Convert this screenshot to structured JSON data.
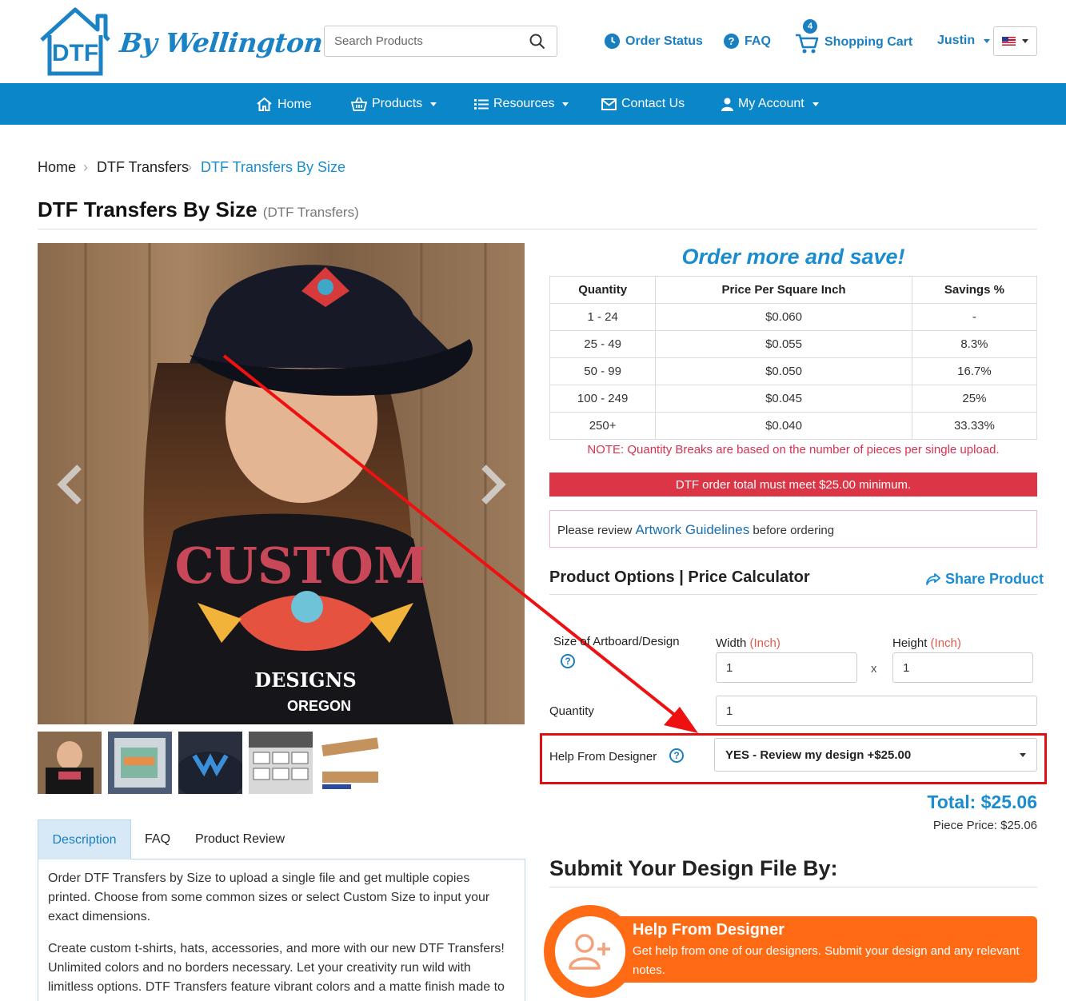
{
  "brand": {
    "logo_letters": "DTF",
    "script_text": "By Wellington",
    "primary_color": "#0a86c9"
  },
  "search": {
    "placeholder": "Search Products"
  },
  "header": {
    "order_status": "Order Status",
    "faq": "FAQ",
    "cart_label": "Shopping Cart",
    "cart_count": "4",
    "user": "Justin"
  },
  "nav": {
    "home": "Home",
    "products": "Products",
    "resources": "Resources",
    "contact": "Contact Us",
    "account": "My Account"
  },
  "breadcrumb": [
    "Home",
    "DTF Transfers",
    "DTF Transfers By Size"
  ],
  "page": {
    "title": "DTF Transfers By Size",
    "subtitle": "(DTF Transfers)"
  },
  "tabs": [
    "Description",
    "FAQ",
    "Product Review"
  ],
  "description": {
    "p1": "Order DTF Transfers by Size to upload a single file and get multiple copies printed. Choose from some common sizes or select Custom Size to input your exact dimensions.",
    "p2": "Create custom t-shirts, hats, accessories, and more with our new DTF Transfers! Unlimited colors and no borders necessary. Let your creativity run wild with limitless options. DTF Transfers feature vibrant colors and a matte finish made to"
  },
  "pricing": {
    "headline": "Order more and save!",
    "headers": [
      "Quantity",
      "Price Per Square Inch",
      "Savings %"
    ],
    "rows": [
      [
        "1 - 24",
        "$0.060",
        "-"
      ],
      [
        "25 - 49",
        "$0.055",
        "8.3%"
      ],
      [
        "50 - 99",
        "$0.050",
        "16.7%"
      ],
      [
        "100 - 249",
        "$0.045",
        "25%"
      ],
      [
        "250+",
        "$0.040",
        "33.33%"
      ]
    ],
    "note": "NOTE: Quantity Breaks are based on the number of pieces per single upload.",
    "minimum": "DTF order total must meet $25.00 minimum.",
    "review_prefix": "Please review ",
    "review_link": "Artwork Guidelines",
    "review_suffix": " before ordering"
  },
  "options": {
    "title": "Product Options | Price Calculator",
    "share": "Share Product",
    "size_label": "Size of Artboard/Design",
    "width_label": "Width",
    "height_label": "Height",
    "unit": "(Inch)",
    "times": "x",
    "width_value": "1",
    "height_value": "1",
    "quantity_label": "Quantity",
    "quantity_value": "1",
    "designer_label": "Help From Designer",
    "designer_value": "YES - Review my design +$25.00"
  },
  "totals": {
    "total": "Total: $25.06",
    "piece": "Piece Price: $25.06"
  },
  "submit": {
    "title": "Submit Your Design File By:",
    "card_title": "Help From Designer",
    "card_text": "Get help from one of our designers. Submit your design and any relevant notes."
  },
  "hero": {
    "shirt_text": "CUSTOM",
    "shirt_sub": "DESIGNS",
    "shirt_city": "OREGON"
  }
}
